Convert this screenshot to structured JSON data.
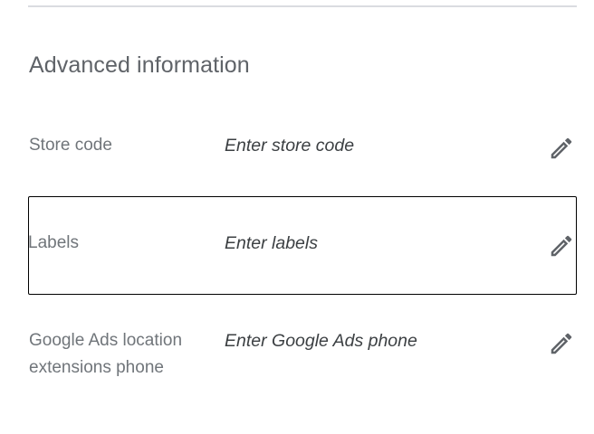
{
  "section": {
    "title": "Advanced information"
  },
  "rows": [
    {
      "label": "Store code",
      "placeholder": "Enter store code",
      "icon": "pencil-icon"
    },
    {
      "label": "Labels",
      "placeholder": "Enter labels",
      "icon": "pencil-icon"
    },
    {
      "label": "Google Ads location extensions phone",
      "placeholder": "Enter Google Ads phone",
      "icon": "pencil-icon"
    }
  ],
  "colors": {
    "title": "#5f6368",
    "label": "#70757a",
    "value": "#3c4043",
    "icon": "#5f6368",
    "divider": "#dadce0",
    "focus_border": "#000000"
  }
}
